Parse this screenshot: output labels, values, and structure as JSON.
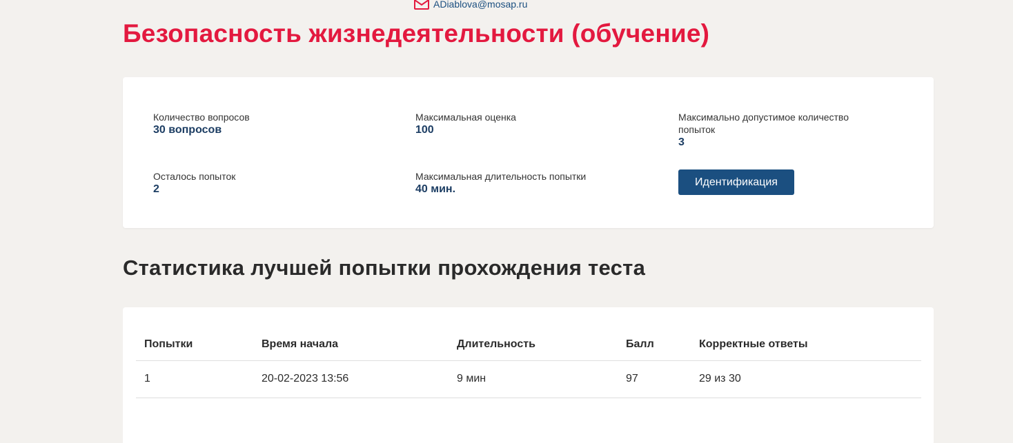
{
  "header": {
    "email": "ADiablova@mosap.ru",
    "title": "Безопасность жизнедеятельности (обучение)"
  },
  "info": {
    "questions_label": "Количество вопросов",
    "questions_value": "30 вопросов",
    "max_score_label": "Максимальная оценка",
    "max_score_value": "100",
    "max_attempts_label": "Максимально допустимое количество попыток",
    "max_attempts_value": "3",
    "remaining_label": "Осталось попыток",
    "remaining_value": "2",
    "max_duration_label": "Максимальная длительность попытки",
    "max_duration_value": "40 мин.",
    "identify_button": "Идентификация"
  },
  "stats": {
    "title": "Статистика лучшей попытки прохождения теста",
    "columns": [
      "Попытки",
      "Время начала",
      "Длительность",
      "Балл",
      "Корректные ответы"
    ],
    "rows": [
      [
        "1",
        "20-02-2023 13:56",
        "9 мин",
        "97",
        "29 из 30"
      ]
    ]
  },
  "colors": {
    "accent": "#e3193f",
    "primary": "#1b4f80",
    "background": "#f3f1ee"
  }
}
